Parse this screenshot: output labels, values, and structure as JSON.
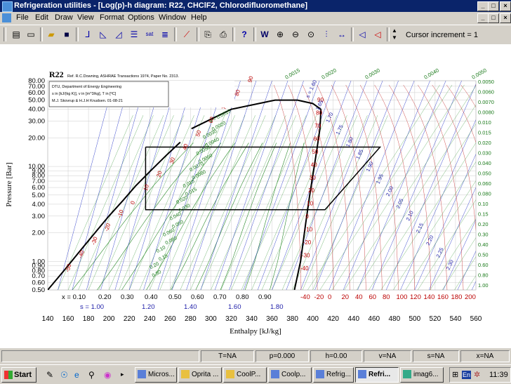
{
  "window": {
    "title": "Refrigeration utilities - [Log(p)-h diagram: R22, CHClF2, Chlorodifluoromethane]"
  },
  "menu": [
    "File",
    "Edit",
    "Draw",
    "View",
    "Format",
    "Options",
    "Window",
    "Help"
  ],
  "toolbar": {
    "cursor_label": "Cursor increment = 1"
  },
  "chart": {
    "refrigerant": "R22",
    "reference": "Ref. R.C.Downing, ASHRAE Transactions 1974, Paper No. 2313.",
    "credits": [
      "DTU, Department of Energy Engineering",
      "s in [kJ/(kg K)], v in [m^3/kg], T in [ºC]",
      "M.J. Skovrup & H.J.H Knudsen. 01-08-21"
    ],
    "xlabel": "Enthalpy [kJ/kg]",
    "ylabel": "Pressure [Bar]",
    "x_ticks": [
      "140",
      "160",
      "180",
      "200",
      "220",
      "240",
      "260",
      "280",
      "300",
      "320",
      "340",
      "360",
      "380",
      "400",
      "420",
      "440",
      "460",
      "480",
      "500",
      "520",
      "540",
      "560"
    ],
    "y_ticks": [
      "80.00",
      "70.00",
      "60.00",
      "50.00",
      "40.00",
      "30.00",
      "20.00",
      "10.00",
      "9.00",
      "8.00",
      "7.00",
      "6.00",
      "5.00",
      "4.00",
      "3.00",
      "2.00",
      "1.00",
      "0.90",
      "0.80",
      "0.70",
      "0.60",
      "0.50"
    ],
    "quality_labels": [
      "x = 0.10",
      "0.20",
      "0.30",
      "0.40",
      "0.50",
      "0.60",
      "0.70",
      "0.80",
      "0.90"
    ],
    "entropy_labels": [
      "s = 1.00",
      "1.20",
      "1.40",
      "1.60",
      "1.80"
    ],
    "temp_labels_bottom": [
      "-40",
      "-20",
      "0",
      "20",
      "40",
      "60",
      "80",
      "100",
      "120",
      "140",
      "160",
      "180",
      "200"
    ],
    "temp_labels_liquid": [
      "-50",
      "-40",
      "-30",
      "-20",
      "-10",
      "0",
      "10",
      "20",
      "30",
      "40",
      "50",
      "60",
      "70",
      "80",
      "90"
    ],
    "temp_labels_vapor": [
      "90",
      "80",
      "70",
      "60",
      "50",
      "40",
      "30",
      "20",
      "10",
      "0",
      "-10",
      "-20",
      "-30",
      "-40"
    ],
    "volume_labels_right": [
      "0.0050",
      "0.0060",
      "0.0070",
      "0.0080",
      "0.010",
      "0.015",
      "0.020",
      "0.030",
      "0.040",
      "0.050",
      "0.060",
      "0.080",
      "0.10",
      "0.15",
      "0.20",
      "0.30",
      "0.40",
      "0.50",
      "0.60",
      "0.80",
      "1.00"
    ],
    "volume_labels_top": [
      "0.0015",
      "0.0020",
      "0.0030",
      "0.0040",
      "0.0050"
    ],
    "entropy_labels_vapor": [
      "s = 1.60",
      "1.65",
      "1.70",
      "1.75",
      "1.80",
      "1.85",
      "1.90",
      "1.95",
      "2.00",
      "2.05",
      "2.10",
      "2.15",
      "2.20",
      "2.25",
      "2.30"
    ],
    "volume_labels_inside": [
      "v = 0.0015",
      "0.0020",
      "0.0030",
      "0.0040",
      "0.0050",
      "0.0060",
      "0.0070",
      "0.0080",
      "0.010",
      "0.015",
      "0.020",
      "0.030",
      "0.040",
      "0.050",
      "0.060",
      "0.080",
      "0.10",
      "0.15",
      "0.20",
      "0.30"
    ],
    "cycle": {
      "p_low": 3.5,
      "p_high": 16,
      "h_points": [
        236,
        412,
        466
      ]
    }
  },
  "chart_data": {
    "type": "line",
    "title": "R22",
    "xlabel": "Enthalpy [kJ/kg]",
    "ylabel": "Pressure [Bar]",
    "x_range": [
      140,
      560
    ],
    "y_range": [
      0.5,
      80
    ],
    "y_scale": "log",
    "series": [
      {
        "x": [
          140,
          156,
          172,
          188,
          200,
          214,
          226,
          240,
          256,
          270
        ],
        "y": [
          0.5,
          0.8,
          1.3,
          2.1,
          3,
          4.4,
          6.2,
          8.8,
          13,
          18
        ]
      },
      {
        "x": [
          281,
          320,
          363,
          385,
          400,
          408
        ],
        "y": [
          25,
          40,
          50,
          50,
          46,
          40
        ]
      },
      {
        "x": [
          408,
          407,
          404,
          400,
          397,
          393,
          388,
          382
        ],
        "y": [
          40,
          25,
          15,
          8,
          5,
          2.5,
          1,
          0.5
        ]
      },
      {
        "x": [
          236,
          236,
          412,
          466,
          412,
          236
        ],
        "y": [
          16,
          3.5,
          3.5,
          16,
          16,
          16
        ]
      }
    ]
  },
  "status": {
    "panels": [
      "T=NA",
      "p=0.000",
      "h=0.00",
      "v=NA",
      "s=NA",
      "x=NA"
    ]
  },
  "taskbar": {
    "start": "Start",
    "tasks": [
      "Micros...",
      "Oprita ...",
      "CoolP...",
      "Coolp...",
      "Refrig...",
      "Refri...",
      "imag6..."
    ],
    "lang": "En",
    "clock": "11:39"
  }
}
